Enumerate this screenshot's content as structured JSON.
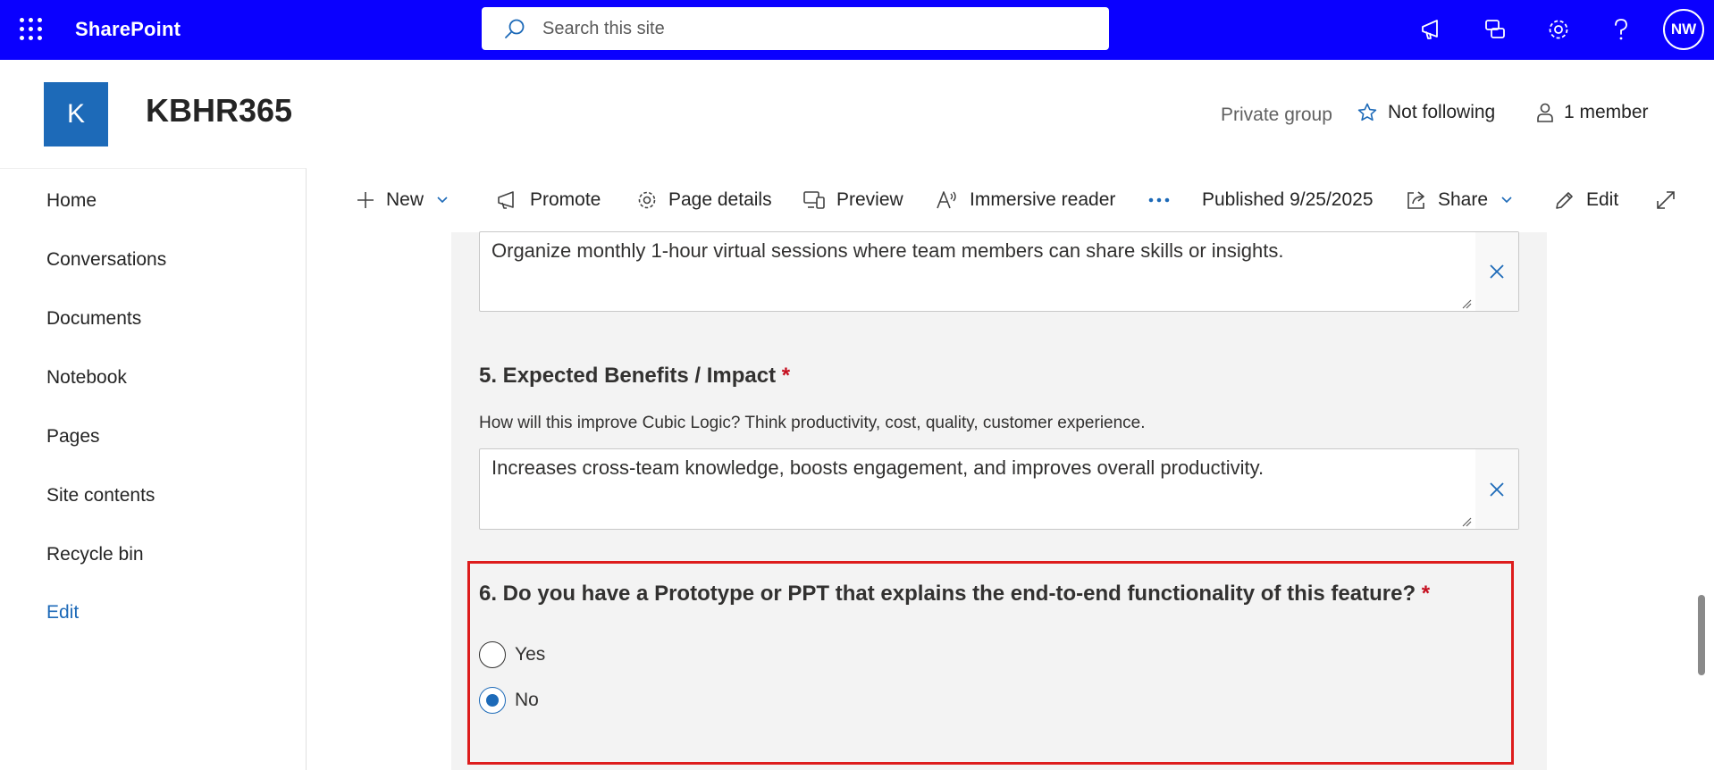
{
  "suite": {
    "brand": "SharePoint",
    "search_placeholder": "Search this site",
    "avatar_initials": "NW",
    "icons": [
      "app-launcher-icon",
      "megaphone-icon",
      "chat-icon",
      "gear-icon",
      "help-icon"
    ],
    "bar_color": "#0a00ff"
  },
  "site": {
    "logo_letter": "K",
    "title": "KBHR365",
    "group_type": "Private group",
    "follow_label": "Not following",
    "members_label": "1 member"
  },
  "nav": {
    "items": [
      "Home",
      "Conversations",
      "Documents",
      "Notebook",
      "Pages",
      "Site contents",
      "Recycle bin"
    ],
    "edit_label": "Edit"
  },
  "commands": {
    "new": "New",
    "promote": "Promote",
    "page_details": "Page details",
    "preview": "Preview",
    "immersive_reader": "Immersive reader",
    "more": "More options",
    "published": "Published 9/25/2025",
    "share": "Share",
    "edit": "Edit"
  },
  "form": {
    "q4_answer": "Organize monthly 1-hour virtual sessions where team members can share skills or insights.",
    "q5": {
      "title": "5. Expected Benefits / Impact",
      "required": "*",
      "subtitle": "How will this improve Cubic Logic? Think productivity, cost, quality, customer experience.",
      "answer": "Increases cross-team knowledge, boosts engagement, and improves overall productivity."
    },
    "q6": {
      "title": "6. Do you have a Prototype or PPT that explains the end-to-end functionality of this feature?",
      "required": "*",
      "options": [
        "Yes",
        "No"
      ],
      "selected": "No"
    }
  },
  "colors": {
    "accent": "#1d6ab8",
    "required": "#c50f1f",
    "highlight_border": "#dd1c1c"
  }
}
